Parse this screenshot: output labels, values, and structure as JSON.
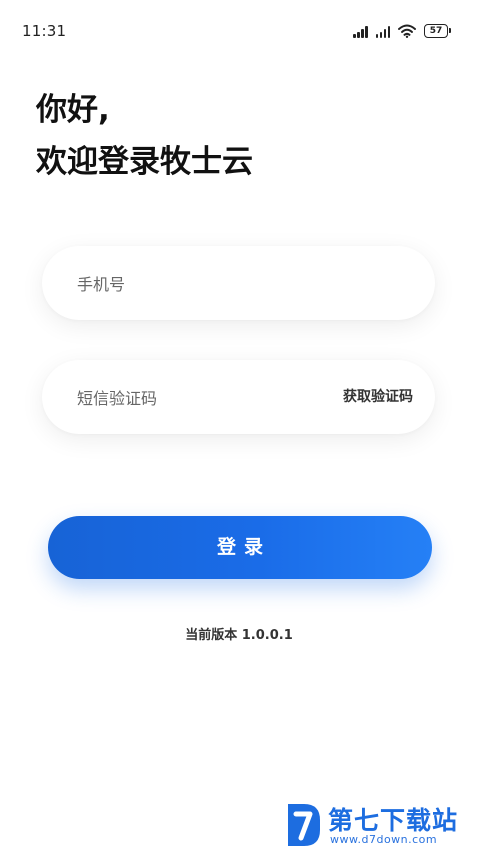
{
  "status_bar": {
    "time": "11:31",
    "battery": "57"
  },
  "greeting": {
    "line1": "你好,",
    "line2": "欢迎登录牧士云"
  },
  "phone_field": {
    "placeholder": "手机号",
    "value": ""
  },
  "code_field": {
    "placeholder": "短信验证码",
    "value": "",
    "get_code_label": "获取验证码"
  },
  "login_button": {
    "label": "登录"
  },
  "version": {
    "text": "当前版本 1.0.0.1"
  },
  "watermark": {
    "title": "第七下载站",
    "url": "www.d7down.com"
  },
  "colors": {
    "primary": "#1a6ce8",
    "watermark": "#1d6de0"
  },
  "icons": [
    "signal-icon",
    "wifi-icon",
    "battery-icon"
  ]
}
